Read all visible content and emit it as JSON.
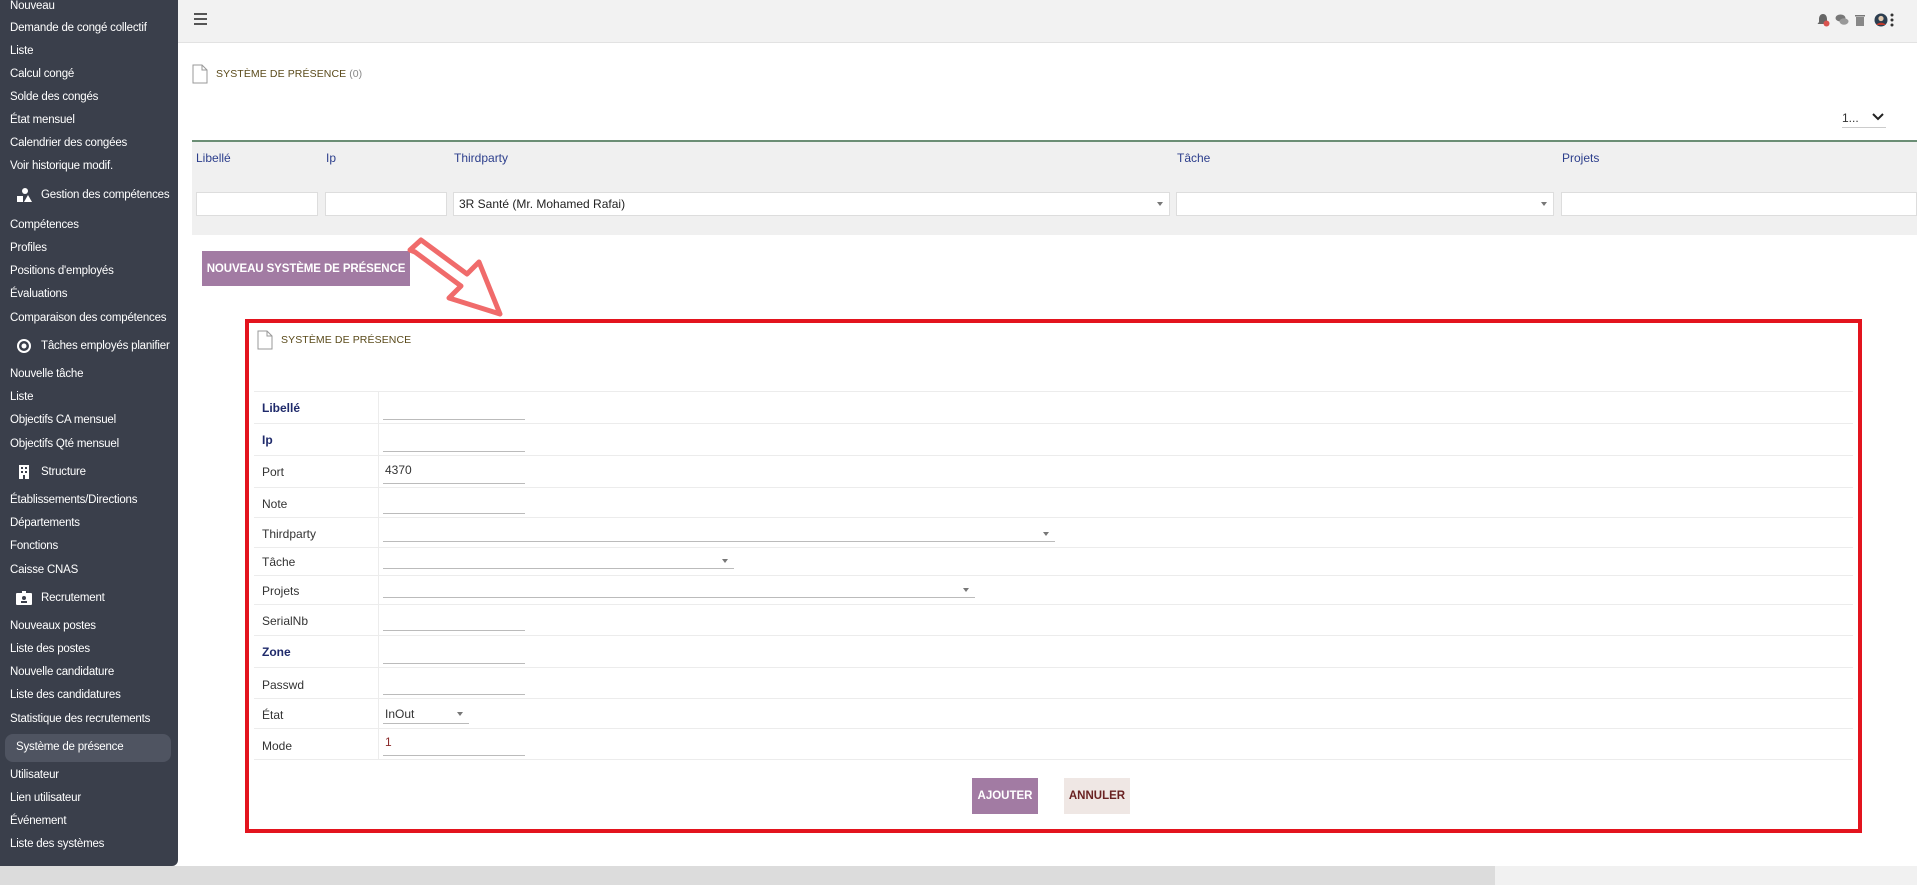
{
  "sidebar": {
    "items": [
      {
        "label": "Nouveau"
      },
      {
        "label": "Demande de congé collectif"
      },
      {
        "label": "Liste"
      },
      {
        "label": "Calcul congé"
      },
      {
        "label": "Solde des congés"
      },
      {
        "label": "État mensuel"
      },
      {
        "label": "Calendrier des congées"
      },
      {
        "label": "Voir historique modif."
      },
      {
        "label": "Gestion des compétences",
        "icon": "shapes-icon"
      },
      {
        "label": "Compétences"
      },
      {
        "label": "Profiles"
      },
      {
        "label": "Positions d'employés"
      },
      {
        "label": "Évaluations"
      },
      {
        "label": "Comparaison des compétences"
      },
      {
        "label": "Tâches employés planifier",
        "icon": "target-icon"
      },
      {
        "label": "Nouvelle tâche"
      },
      {
        "label": "Liste"
      },
      {
        "label": "Objectifs CA mensuel"
      },
      {
        "label": "Objectifs Qté mensuel"
      },
      {
        "label": "Structure",
        "icon": "building-icon"
      },
      {
        "label": "Établissements/Directions"
      },
      {
        "label": "Départements"
      },
      {
        "label": "Fonctions"
      },
      {
        "label": "Caisse CNAS"
      },
      {
        "label": "Recrutement",
        "icon": "id-badge-icon"
      },
      {
        "label": "Nouveaux postes"
      },
      {
        "label": "Liste des postes"
      },
      {
        "label": "Nouvelle candidature"
      },
      {
        "label": "Liste des candidatures"
      },
      {
        "label": "Statistique des recrutements"
      },
      {
        "label": "Système de présence",
        "active": true
      },
      {
        "label": "Utilisateur"
      },
      {
        "label": "Lien utilisateur"
      },
      {
        "label": "Événement"
      },
      {
        "label": "Liste des systèmes"
      }
    ]
  },
  "topbar": {
    "icons": [
      "notification-icon",
      "chat-icon",
      "trash-icon",
      "user-avatar-icon",
      "more-vertical-icon"
    ]
  },
  "page": {
    "title": "SYSTÈME DE PRÉSENCE",
    "count": "(0)",
    "pagination_select": "1..."
  },
  "filters": {
    "headers": {
      "libelle": "Libellé",
      "ip": "Ip",
      "thirdparty": "Thirdparty",
      "tache": "Tâche",
      "projets": "Projets"
    },
    "values": {
      "libelle": "",
      "ip": "",
      "thirdparty": "3R Santé (Mr. Mohamed Rafai)",
      "tache": "",
      "projets": ""
    }
  },
  "new_button_label": "NOUVEAU SYSTÈME DE PRÉSENCE",
  "form": {
    "title": "SYSTÈME DE PRÉSENCE",
    "fields": [
      {
        "label": "Libellé",
        "value": ""
      },
      {
        "label": "Ip",
        "value": ""
      },
      {
        "label": "Port",
        "value": "4370"
      },
      {
        "label": "Note",
        "value": ""
      },
      {
        "label": "Thirdparty",
        "value": ""
      },
      {
        "label": "Tâche",
        "value": ""
      },
      {
        "label": "Projets",
        "value": ""
      },
      {
        "label": "SerialNb",
        "value": ""
      },
      {
        "label": "Zone",
        "value": ""
      },
      {
        "label": "Passwd",
        "value": ""
      },
      {
        "label": "État",
        "value": "InOut"
      },
      {
        "label": "Mode",
        "value": "1"
      }
    ],
    "submit_label": "AJOUTER",
    "cancel_label": "ANNULER"
  },
  "colors": {
    "sidebar_bg": "#3a3f4b",
    "button_primary": "#a27ba3",
    "highlight_border": "#e3141e",
    "arrow": "#f06b6b"
  }
}
